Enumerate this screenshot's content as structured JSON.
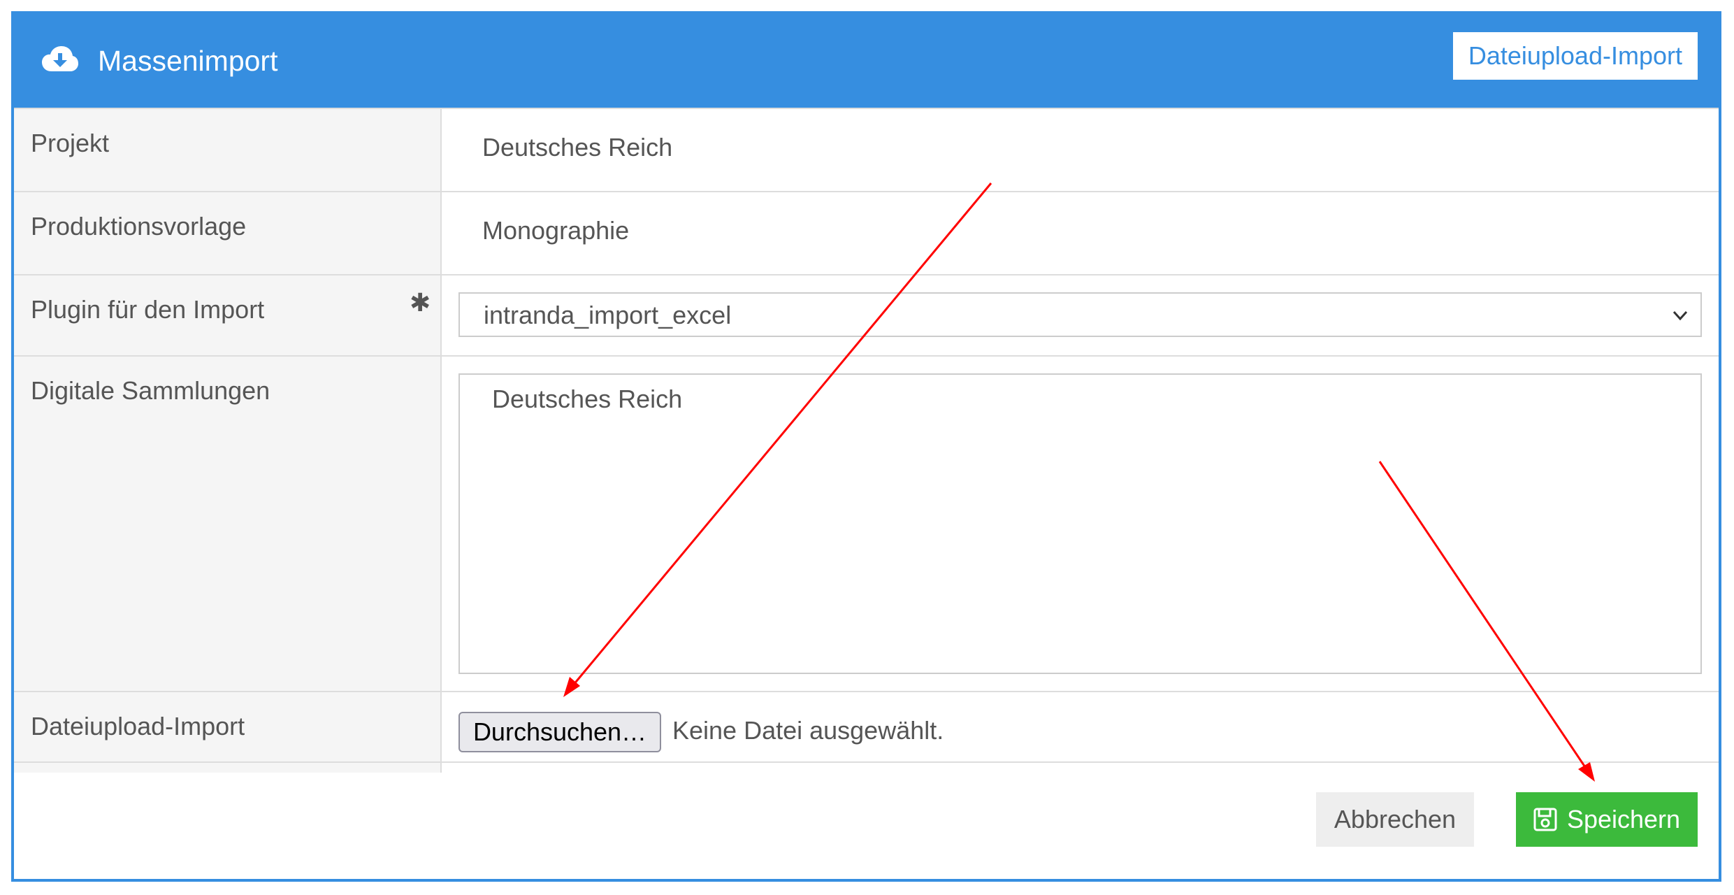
{
  "header": {
    "title": "Massenimport",
    "icon": "cloud-download-icon",
    "upload_button_label": "Dateiupload-Import",
    "color": "#368ee0"
  },
  "form": {
    "project": {
      "label": "Projekt",
      "value": "Deutsches Reich"
    },
    "template": {
      "label": "Produktionsvorlage",
      "value": "Monographie"
    },
    "plugin": {
      "label": "Plugin für den Import",
      "required_marker": "✱",
      "selected": "intranda_import_excel"
    },
    "collections": {
      "label": "Digitale Sammlungen",
      "value": "Deutsches Reich"
    },
    "upload": {
      "label": "Dateiupload-Import",
      "browse_label": "Durchsuchen…",
      "status": "Keine Datei ausgewählt."
    }
  },
  "footer": {
    "cancel_label": "Abbrechen",
    "save_label": "Speichern",
    "save_icon": "floppy-disk-icon",
    "save_color": "#3cba3c"
  },
  "annotations": {
    "arrow_color": "#ff0000"
  }
}
